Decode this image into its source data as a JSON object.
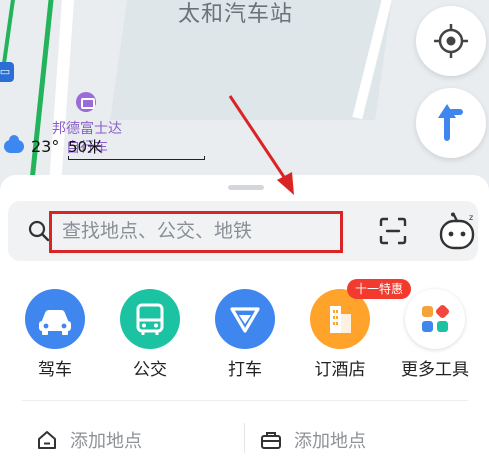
{
  "map": {
    "station_name": "太和汽车站",
    "poi_name": "邦德富士达自行车",
    "weather_temp": "23°",
    "scale_label": "50米",
    "bus_stop_icon": "bus-stop-icon",
    "locate_icon": "crosshair-icon",
    "navigate_icon": "route-arrow-icon"
  },
  "search": {
    "placeholder": "查找地点、公交、地铁",
    "scan_icon": "scan-icon",
    "assistant_icon": "assistant-face-icon"
  },
  "actions": [
    {
      "label": "驾车",
      "icon": "car-icon",
      "color": "#3f86ef"
    },
    {
      "label": "公交",
      "icon": "bus-icon",
      "color": "#1cc3a2"
    },
    {
      "label": "打车",
      "icon": "taxi-icon",
      "color": "#3f86ef"
    },
    {
      "label": "订酒店",
      "icon": "hotel-icon",
      "color": "#ffa32b",
      "badge": "十一特惠"
    },
    {
      "label": "更多工具",
      "icon": "more-tools-icon",
      "color": "#ffffff"
    }
  ],
  "places": {
    "home_label": "添加地点",
    "work_label": "添加地点"
  },
  "colors": {
    "accent": "#3f86ef",
    "annotation": "#d92525"
  }
}
